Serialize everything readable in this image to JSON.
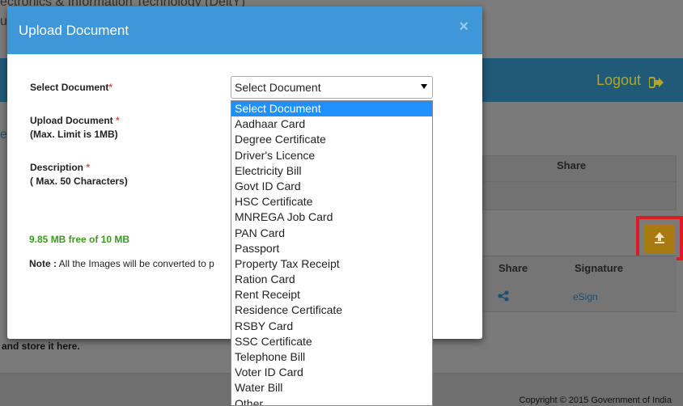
{
  "background": {
    "org_line1": "ectronics & Information Technology (DeitY)",
    "org_line2": "u",
    "logout": "Logout",
    "side_letter": "e",
    "table1_share_header": "Share",
    "table2_share_header": "Share",
    "table2_signature_header": "Signature",
    "esign_link": "eSign",
    "store_text": "and store it here.",
    "copyright": "Copyright © 2015 Government of India",
    "colors": {
      "nav": "#1f5a78",
      "logout": "#b3a52a",
      "upload_button": "#a87a10",
      "highlight": "#e01a25"
    }
  },
  "modal": {
    "title": "Upload Document",
    "close": "×",
    "colors": {
      "header": "#3d97d8",
      "free_space": "#3c9a1a",
      "required": "#d9534f"
    },
    "select_document_label": "Select Document",
    "upload_document_label": "Upload Document",
    "upload_limit": "(Max. Limit is 1MB)",
    "description_label": "Description",
    "description_limit": "( Max. 50 Characters)",
    "required_mark": "*",
    "free_space": "9.85 MB free of 10 MB",
    "note_prefix": "Note :",
    "note_text": "All the Images will be converted to p",
    "select_value": "Select Document"
  },
  "dropdown": {
    "options": [
      "Select Document",
      "Aadhaar Card",
      "Degree Certificate",
      "Driver's Licence",
      "Electricity Bill",
      "Govt ID Card",
      "HSC Certificate",
      "MNREGA Job Card",
      "PAN Card",
      "Passport",
      "Property Tax Receipt",
      "Ration Card",
      "Rent Receipt",
      "Residence Certificate",
      "RSBY Card",
      "SSC Certificate",
      "Telephone Bill",
      "Voter ID Card",
      "Water Bill",
      "Other"
    ],
    "highlighted_option": "Select Document"
  }
}
